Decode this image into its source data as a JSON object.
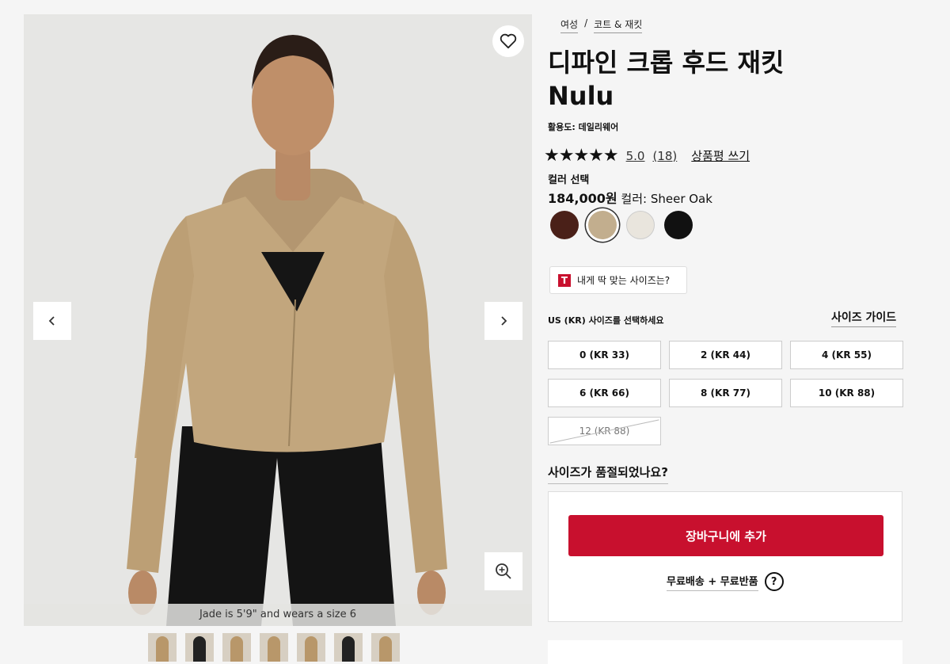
{
  "gallery": {
    "caption": "Jade is 5'9\" and wears a size 6",
    "icons": {
      "favorite": "heart-icon",
      "prev": "chevron-left-icon",
      "next": "chevron-right-icon",
      "zoom": "zoom-in-icon"
    },
    "thumbnail_count": 7
  },
  "breadcrumb": [
    "여성",
    "코트 & 재킷"
  ],
  "product": {
    "title_line1": "디파인 크롭 후드 재킷",
    "title_line2": "Nulu",
    "activity": "활용도: 데일리웨어",
    "stars": "★★★★★",
    "rating": "5.0",
    "review_count": "(18)",
    "write_review": "상품평 쓰기",
    "color_select_label": "컬러 선택",
    "price": "184,000원",
    "color_prefix": "컬러:",
    "color_name": "Sheer Oak"
  },
  "swatches": [
    {
      "name": "dark-brown",
      "color": "#4a2018",
      "selected": false
    },
    {
      "name": "sheer-oak",
      "color": "#c2ae8e",
      "selected": true
    },
    {
      "name": "bone",
      "color": "#e9e5dd",
      "selected": false
    },
    {
      "name": "black",
      "color": "#111111",
      "selected": false
    }
  ],
  "fit_finder": {
    "logo": "T",
    "label": "내게 딱 맞는 사이즈는?"
  },
  "size": {
    "label": "US (KR) 사이즈를 선택하세요",
    "guide": "사이즈 가이드",
    "options": [
      {
        "label": "0 (KR 33)",
        "available": true
      },
      {
        "label": "2 (KR 44)",
        "available": true
      },
      {
        "label": "4 (KR 55)",
        "available": true
      },
      {
        "label": "6 (KR 66)",
        "available": true
      },
      {
        "label": "8 (KR 77)",
        "available": true
      },
      {
        "label": "10 (KR 88)",
        "available": true
      },
      {
        "label": "12 (KR 88)",
        "available": false
      }
    ],
    "soldout_question": "사이즈가 품절되었나요?"
  },
  "cart": {
    "add_to_cart": "장바구니에 추가",
    "shipping": "무료배송 + 무료반품",
    "help": "?",
    "accent": "#c8102e"
  }
}
